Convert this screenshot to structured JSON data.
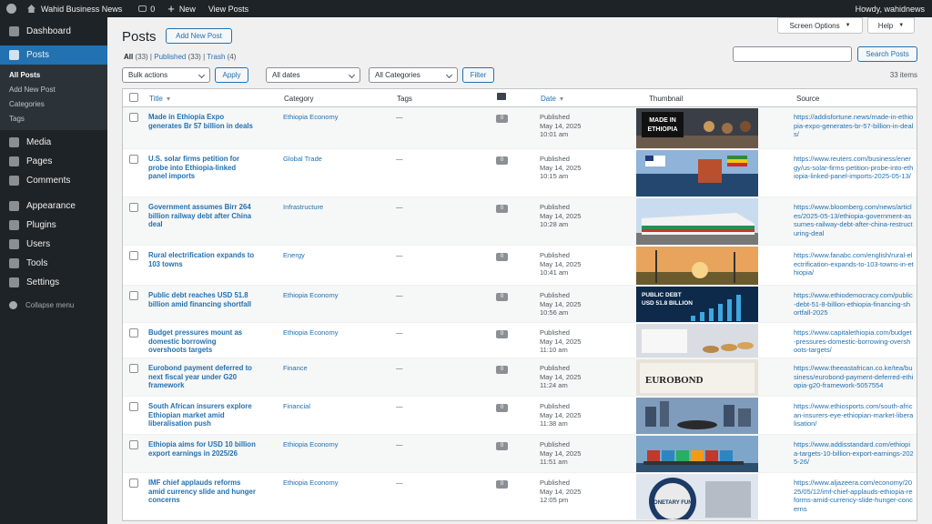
{
  "adminbar": {
    "site_name": "Wahid Business News",
    "comments_count": "0",
    "new_label": "New",
    "view_posts_label": "View Posts",
    "greeting": "Howdy, wahidnews"
  },
  "sidebar": {
    "items": [
      {
        "label": "Dashboard",
        "icon": "dashboard-icon"
      },
      {
        "label": "Posts",
        "icon": "pin-icon"
      },
      {
        "label": "Media",
        "icon": "media-icon"
      },
      {
        "label": "Pages",
        "icon": "pages-icon"
      },
      {
        "label": "Comments",
        "icon": "comments-icon"
      },
      {
        "label": "Appearance",
        "icon": "brush-icon"
      },
      {
        "label": "Plugins",
        "icon": "plugin-icon"
      },
      {
        "label": "Users",
        "icon": "users-icon"
      },
      {
        "label": "Tools",
        "icon": "wrench-icon"
      },
      {
        "label": "Settings",
        "icon": "settings-icon"
      }
    ],
    "posts_submenu": [
      "All Posts",
      "Add New Post",
      "Categories",
      "Tags"
    ],
    "collapse_label": "Collapse menu"
  },
  "header": {
    "title": "Posts",
    "add_new": "Add New Post",
    "screen_options": "Screen Options",
    "help": "Help"
  },
  "views": {
    "all": "All",
    "all_count": "(33)",
    "published": "Published",
    "published_count": "(33)",
    "trash": "Trash",
    "trash_count": "(4)"
  },
  "search": {
    "button": "Search Posts",
    "value": ""
  },
  "filters": {
    "bulk_actions": "Bulk actions",
    "apply": "Apply",
    "dates": "All dates",
    "categories": "All Categories",
    "filter": "Filter",
    "items_count": "33 items"
  },
  "table": {
    "columns": {
      "title": "Title",
      "category": "Category",
      "tags": "Tags",
      "date": "Date",
      "thumbnail": "Thumbnail",
      "source": "Source"
    },
    "rows": [
      {
        "title": "Made in Ethiopia Expo generates Br 57 billion in deals",
        "category": "Ethiopia Economy",
        "tags": "—",
        "comments": "0",
        "status": "Published",
        "date": "May 14, 2025",
        "time": "10:01 am",
        "thumb_text": "MADE IN ETHIOPIA",
        "source": "https://addisfortune.news/made-in-ethiopia-expo-generates-br-57-billion-in-deals/"
      },
      {
        "title": "U.S. solar firms petition for probe into Ethiopia-linked panel imports",
        "category": "Global Trade",
        "tags": "—",
        "comments": "0",
        "status": "Published",
        "date": "May 14, 2025",
        "time": "10:15 am",
        "thumb_text": "",
        "source": "https://www.reuters.com/business/energy/us-solar-firms-petition-probe-into-ethiopia-linked-panel-imports-2025-05-13/"
      },
      {
        "title": "Government assumes Birr 264 billion railway debt after China deal",
        "category": "Infrastructure",
        "tags": "—",
        "comments": "0",
        "status": "Published",
        "date": "May 14, 2025",
        "time": "10:28 am",
        "thumb_text": "",
        "source": "https://www.bloomberg.com/news/articles/2025-05-13/ethiopia-government-assumes-railway-debt-after-china-restructuring-deal"
      },
      {
        "title": "Rural electrification expands to 103 towns",
        "category": "Energy",
        "tags": "—",
        "comments": "0",
        "status": "Published",
        "date": "May 14, 2025",
        "time": "10:41 am",
        "thumb_text": "",
        "source": "https://www.fanabc.com/english/rural-electrification-expands-to-103-towns-in-ethiopia/"
      },
      {
        "title": "Public debt reaches USD 51.8 billion amid financing shortfall",
        "category": "Ethiopia Economy",
        "tags": "—",
        "comments": "0",
        "status": "Published",
        "date": "May 14, 2025",
        "time": "10:56 am",
        "thumb_text": "PUBLIC DEBT USD 51.8 BILLION",
        "source": "https://www.ethiodemocracy.com/public-debt-51-8-billion-ethiopia-financing-shortfall-2025"
      },
      {
        "title": "Budget pressures mount as domestic borrowing overshoots targets",
        "category": "Ethiopia Economy",
        "tags": "—",
        "comments": "0",
        "status": "Published",
        "date": "May 14, 2025",
        "time": "11:10 am",
        "thumb_text": "",
        "source": "https://www.capitalethiopia.com/budget-pressures-domestic-borrowing-overshoots-targets/"
      },
      {
        "title": "Eurobond payment deferred to next fiscal year under G20 framework",
        "category": "Finance",
        "tags": "—",
        "comments": "0",
        "status": "Published",
        "date": "May 14, 2025",
        "time": "11:24 am",
        "thumb_text": "EUROBOND",
        "source": "https://www.theeastafrican.co.ke/tea/business/eurobond-payment-deferred-ethiopia-g20-framework-5057554"
      },
      {
        "title": "South African insurers explore Ethiopian market amid liberalisation push",
        "category": "Financial",
        "tags": "—",
        "comments": "0",
        "status": "Published",
        "date": "May 14, 2025",
        "time": "11:38 am",
        "thumb_text": "",
        "source": "https://www.ethiosports.com/south-african-insurers-eye-ethiopian-market-liberalisation/"
      },
      {
        "title": "Ethiopia aims for USD 10 billion export earnings in 2025/26",
        "category": "Ethiopia Economy",
        "tags": "—",
        "comments": "0",
        "status": "Published",
        "date": "May 14, 2025",
        "time": "11:51 am",
        "thumb_text": "",
        "source": "https://www.addisstandard.com/ethiopia-targets-10-billion-export-earnings-2025-26/"
      },
      {
        "title": "IMF chief applauds reforms amid currency slide and hunger concerns",
        "category": "Ethiopia Economy",
        "tags": "—",
        "comments": "0",
        "status": "Published",
        "date": "May 14, 2025",
        "time": "12:05 pm",
        "thumb_text": "MONETARY FUND",
        "source": "https://www.aljazeera.com/economy/2025/05/12/imf-chief-applauds-ethiopia-reforms-amid-currency-slide-hunger-concerns"
      }
    ]
  }
}
